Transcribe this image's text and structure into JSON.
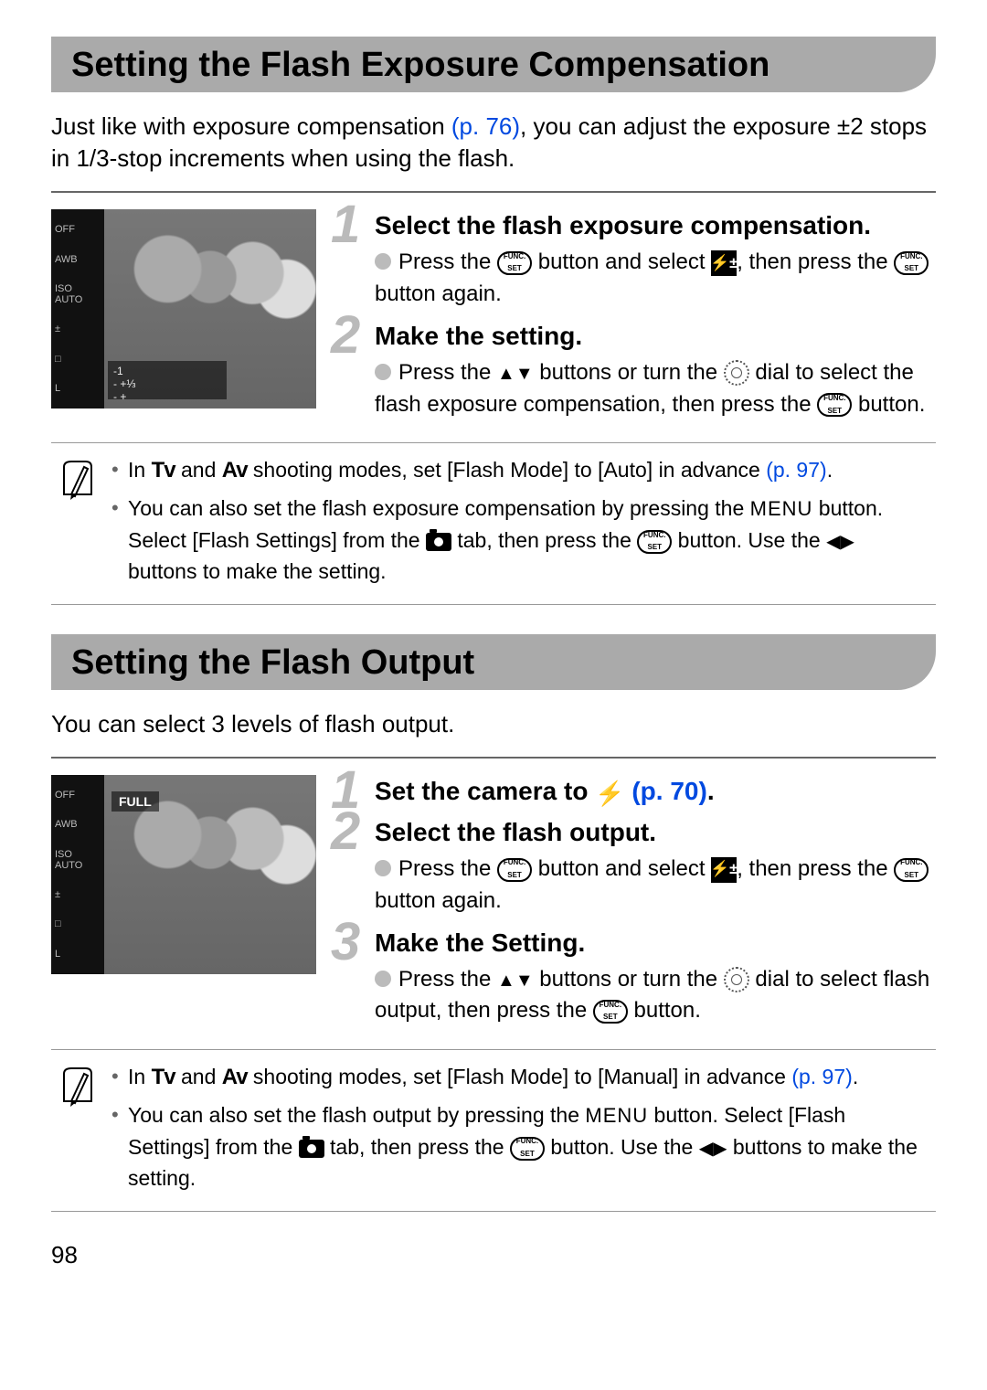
{
  "page_number": "98",
  "section1": {
    "title": "Setting the Flash Exposure Compensation",
    "intro_a": "Just like with exposure compensation ",
    "intro_link": "(p. 76)",
    "intro_b": ", you can adjust the exposure ±2 stops in 1/3-stop increments when using the flash.",
    "thumb_sidebar_items": [
      "OFF",
      "AWB",
      "ISO AUTO",
      "±",
      "□",
      "L"
    ],
    "thumb_ev_line1": "-1",
    "thumb_ev_line2": "- +⅓",
    "thumb_ev_line3": "- +",
    "step1_title": "Select the flash exposure compensation.",
    "step1_body_a": "Press the ",
    "step1_body_b": " button and select ",
    "step1_body_c": ", then press the ",
    "step1_body_d": " button again.",
    "step2_title": "Make the setting.",
    "step2_body_a": "Press the ",
    "step2_body_b": " buttons or turn the ",
    "step2_body_c": " dial to select the flash exposure compensation, then press the ",
    "step2_body_d": " button.",
    "note1_a": "In ",
    "note1_b": " and ",
    "note1_c": " shooting modes, set [Flash Mode] to [Auto] in advance ",
    "note1_link": "(p. 97)",
    "note1_end": ".",
    "note2_a": "You can also set the flash exposure compensation by pressing the ",
    "note2_b": " button. Select [Flash Settings] from the ",
    "note2_c": " tab, then press the ",
    "note2_d": " button. Use the ",
    "note2_e": " buttons to make the setting."
  },
  "section2": {
    "title": "Setting the Flash Output",
    "intro": "You can select 3 levels of flash output.",
    "thumb_full_label": "FULL",
    "step1_title_a": "Set the camera to ",
    "step1_title_link": "(p. 70)",
    "step1_title_end": ".",
    "step2_title": "Select the flash output.",
    "step2_body_a": "Press the ",
    "step2_body_b": " button and select ",
    "step2_body_c": ", then press the ",
    "step2_body_d": " button again.",
    "step3_title": "Make the Setting.",
    "step3_body_a": "Press the ",
    "step3_body_b": " buttons or turn the ",
    "step3_body_c": " dial to select flash output, then press the ",
    "step3_body_d": " button.",
    "note1_a": "In ",
    "note1_b": " and ",
    "note1_c": " shooting modes, set [Flash Mode] to [Manual] in advance ",
    "note1_link": "(p. 97)",
    "note1_end": ".",
    "note2_a": "You can also set the flash output by pressing the ",
    "note2_b": " button. Select [Flash Settings] from the ",
    "note2_c": " tab, then press the ",
    "note2_d": " button. Use the ",
    "note2_e": " buttons to make the setting."
  },
  "icons": {
    "func_top": "FUNC.",
    "func_bot": "SET",
    "tv": "Tv",
    "av": "Av",
    "menu": "MENU",
    "flash_glyph": "⚡"
  }
}
